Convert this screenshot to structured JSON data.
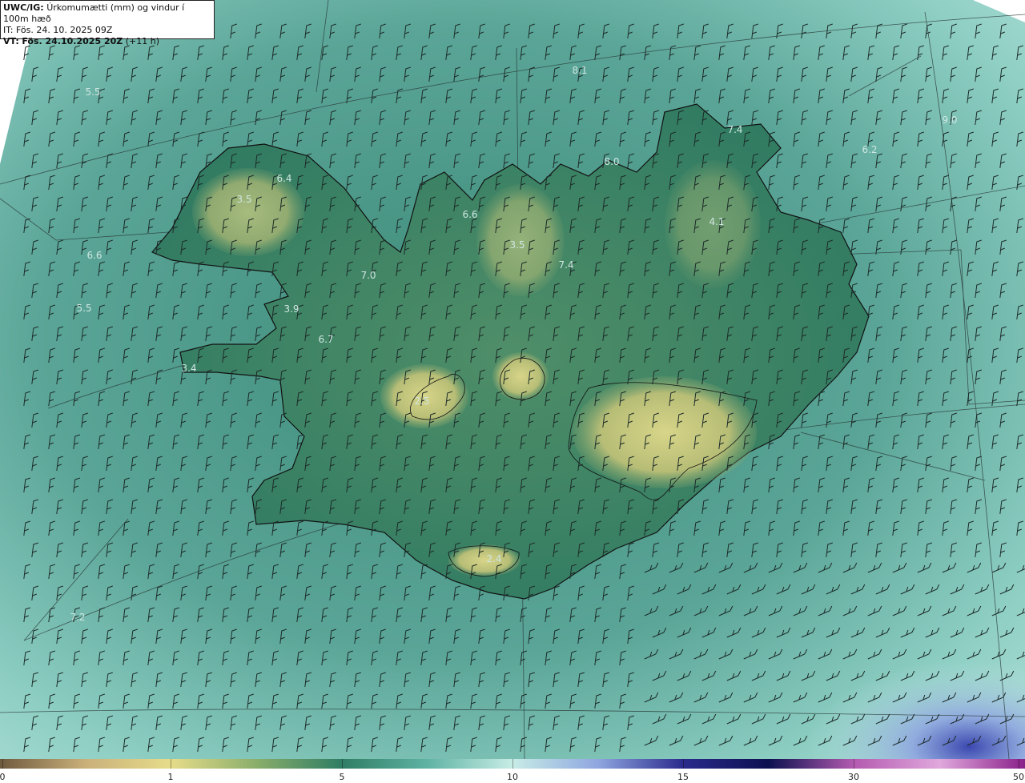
{
  "header": {
    "product": "UWC/IG:",
    "title": "Úrkomumætti (mm) og vindur í 100m hæð",
    "initial_time": "IT: Fös. 24. 10. 2025 09Z",
    "valid_prefix": "VT:",
    "valid_time": "Fös. 24.10.2025 20Z",
    "lead": "(+11 h)"
  },
  "value_labels": [
    {
      "text": "5.5"
    },
    {
      "text": "8.1"
    },
    {
      "text": "7.4"
    },
    {
      "text": "9.0"
    },
    {
      "text": "6.2"
    },
    {
      "text": "8.0"
    },
    {
      "text": "6.4"
    },
    {
      "text": "3.5"
    },
    {
      "text": "6.6"
    },
    {
      "text": "3.5"
    },
    {
      "text": "4.1"
    },
    {
      "text": "6.6"
    },
    {
      "text": "7.4"
    },
    {
      "text": "7.0"
    },
    {
      "text": "5.5"
    },
    {
      "text": "3.9"
    },
    {
      "text": "6.7"
    },
    {
      "text": "3.4"
    },
    {
      "text": "2.5"
    },
    {
      "text": "2.4"
    },
    {
      "text": "7.2"
    }
  ],
  "colorbar": {
    "ticks": [
      "0",
      "1",
      "5",
      "10",
      "15",
      "30",
      "50"
    ],
    "colors": [
      "#6f5a3e",
      "#c9b07a",
      "#e6dc8a",
      "#8aae6a",
      "#2f7d64",
      "#5fb3a3",
      "#c7ece6",
      "#8fa6e0",
      "#2a2a8c",
      "#0c1050",
      "#b45bb0",
      "#e0a8dc",
      "#8a1f8a"
    ]
  },
  "colors": {
    "sea": "#5aa597",
    "land_low": "#2f7a62",
    "land_high": "#bfc27a",
    "coast": "#111111",
    "barb": "#1c2a28"
  }
}
